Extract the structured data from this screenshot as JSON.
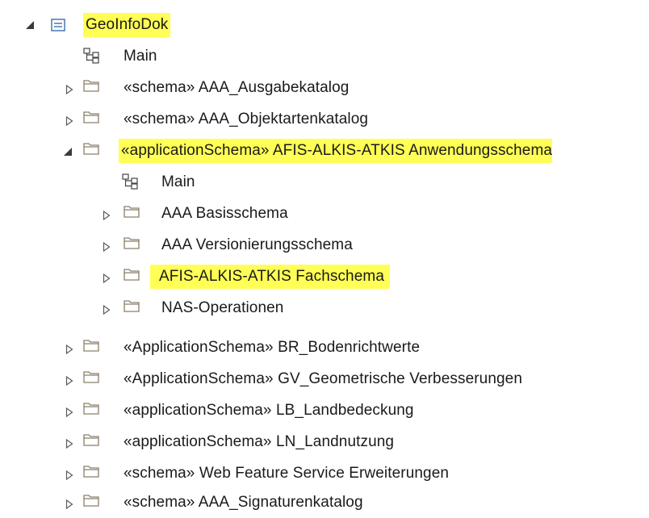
{
  "colors": {
    "highlight": "#ffff56",
    "folder_stroke": "#8a7f6a",
    "arrow_stroke": "#5a5a5a",
    "package_stroke": "#3c6ea8"
  },
  "tree": {
    "root": {
      "label": "GeoInfoDok",
      "icon": "package-icon",
      "expanded": true,
      "highlighted": true
    },
    "items": [
      {
        "label": "Main",
        "icon": "diagram-icon",
        "expandable": false
      },
      {
        "label": "«schema» AAA_Ausgabekatalog",
        "icon": "folder-icon",
        "expandable": true
      },
      {
        "label": "«schema» AAA_Objektartenkatalog",
        "icon": "folder-icon",
        "expandable": true
      },
      {
        "label": "«applicationSchema» AFIS-ALKIS-ATKIS Anwendungsschema",
        "icon": "folder-icon",
        "expandable": true,
        "expanded": true,
        "highlighted": true
      },
      {
        "label": "Main",
        "icon": "diagram-icon",
        "expandable": false
      },
      {
        "label": "AAA Basisschema",
        "icon": "folder-icon",
        "expandable": true
      },
      {
        "label": "AAA Versionierungsschema",
        "icon": "folder-icon",
        "expandable": true
      },
      {
        "label": "AFIS-ALKIS-ATKIS Fachschema",
        "icon": "folder-icon",
        "expandable": true,
        "highlighted": true
      },
      {
        "label": "NAS-Operationen",
        "icon": "folder-icon",
        "expandable": true
      },
      {
        "label": "«ApplicationSchema» BR_Bodenrichtwerte",
        "icon": "folder-icon",
        "expandable": true
      },
      {
        "label": "«ApplicationSchema» GV_Geometrische Verbesserungen",
        "icon": "folder-icon",
        "expandable": true
      },
      {
        "label": "«applicationSchema» LB_Landbedeckung",
        "icon": "folder-icon",
        "expandable": true
      },
      {
        "label": "«applicationSchema» LN_Landnutzung",
        "icon": "folder-icon",
        "expandable": true
      },
      {
        "label": "«schema» Web Feature Service Erweiterungen",
        "icon": "folder-icon",
        "expandable": true
      },
      {
        "label": "«schema» AAA_Signaturenkatalog",
        "icon": "folder-icon",
        "expandable": true
      }
    ]
  }
}
